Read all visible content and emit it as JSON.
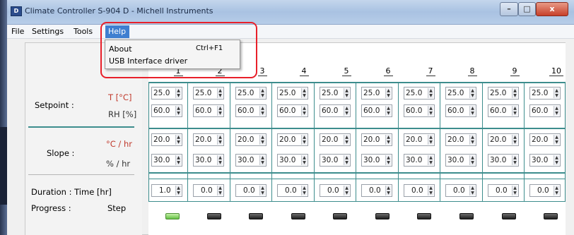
{
  "window": {
    "title": "Climate Controller S-904 D  -  Michell Instruments",
    "minimize_glyph": "–",
    "maximize_glyph": "□",
    "close_glyph": "x"
  },
  "menu": {
    "file": "File",
    "settings": "Settings",
    "tools": "Tools",
    "help": "Help"
  },
  "help_menu": {
    "items": [
      {
        "label": "About",
        "shortcut": "Ctrl+F1"
      },
      {
        "label": "USB Interface driver",
        "shortcut": ""
      }
    ]
  },
  "labels": {
    "setpoint": "Setpoint :",
    "t_unit": "T [°C]",
    "rh_unit": "RH [%]",
    "slope": "Slope :",
    "slope_t_unit": "°C / hr",
    "slope_rh_unit": "% / hr",
    "duration": "Duration  :  Time [hr]",
    "progress": "Progress :",
    "step": "Step"
  },
  "columns": [
    "1",
    "2",
    "3",
    "4",
    "5",
    "6",
    "7",
    "8",
    "9",
    "10"
  ],
  "setpoint_t": [
    "25.0",
    "25.0",
    "25.0",
    "25.0",
    "25.0",
    "25.0",
    "25.0",
    "25.0",
    "25.0",
    "25.0"
  ],
  "setpoint_rh": [
    "60.0",
    "60.0",
    "60.0",
    "60.0",
    "60.0",
    "60.0",
    "60.0",
    "60.0",
    "60.0",
    "60.0"
  ],
  "slope_t": [
    "20.0",
    "20.0",
    "20.0",
    "20.0",
    "20.0",
    "20.0",
    "20.0",
    "20.0",
    "20.0",
    "20.0"
  ],
  "slope_rh": [
    "30.0",
    "30.0",
    "30.0",
    "30.0",
    "30.0",
    "30.0",
    "30.0",
    "30.0",
    "30.0",
    "30.0"
  ],
  "duration": [
    "1.0",
    "0.0",
    "0.0",
    "0.0",
    "0.0",
    "0.0",
    "0.0",
    "0.0",
    "0.0",
    "0.0"
  ],
  "progress_active_step": 1
}
